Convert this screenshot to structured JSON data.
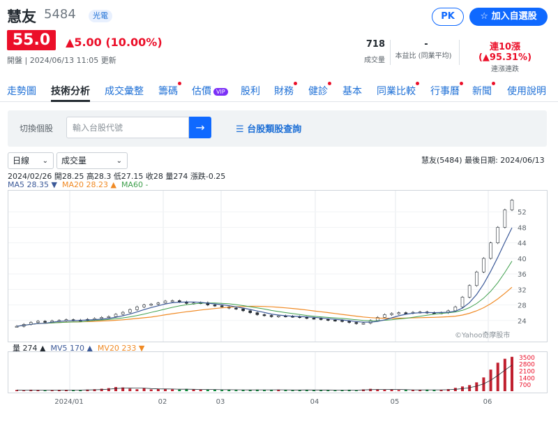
{
  "stock": {
    "name": "慧友",
    "code": "5484",
    "sector": "光電",
    "price": "55.0",
    "change": "5.00 (10.00%)",
    "market_time": "開盤 | 2024/06/13 11:05 更新"
  },
  "actions": {
    "pk": "PK",
    "watch": "加入自選股"
  },
  "stats": [
    {
      "value": "718",
      "label": "成交量",
      "color": "#232a31"
    },
    {
      "value": "-",
      "label": "本益比 (同業平均)",
      "color": "#232a31"
    },
    {
      "value": "連10漲 (▲95.31%)",
      "label": "連漲連跌",
      "color": "#eb0f29"
    }
  ],
  "tabs": [
    {
      "label": "走勢圖",
      "dot": false,
      "vip": false
    },
    {
      "label": "技術分析",
      "dot": false,
      "vip": false,
      "active": true
    },
    {
      "label": "成交彙整",
      "dot": false,
      "vip": false
    },
    {
      "label": "籌碼",
      "dot": true,
      "vip": false
    },
    {
      "label": "估價",
      "dot": false,
      "vip": true
    },
    {
      "label": "股利",
      "dot": false,
      "vip": false
    },
    {
      "label": "財務",
      "dot": true,
      "vip": false
    },
    {
      "label": "健診",
      "dot": true,
      "vip": false
    },
    {
      "label": "基本",
      "dot": false,
      "vip": false
    },
    {
      "label": "同業比較",
      "dot": true,
      "vip": false
    },
    {
      "label": "行事曆",
      "dot": true,
      "vip": false
    },
    {
      "label": "新聞",
      "dot": true,
      "vip": false
    },
    {
      "label": "使用說明",
      "dot": false,
      "vip": false
    }
  ],
  "vip_badge": "VIP",
  "search": {
    "label": "切換個股",
    "placeholder": "輸入台股代號",
    "go": "→",
    "browse": "台股類股查詢"
  },
  "controls": {
    "period": "日線",
    "indicator": "成交量"
  },
  "chart_info": "慧友(5484)   最後日期: 2024/06/13",
  "ohlc": "2024/02/26 開28.25 高28.3 低27.15 收28 量274 漲跌-0.25",
  "ma_legend": [
    {
      "text": "MA5 28.35 ▼",
      "color": "#3b5998"
    },
    {
      "text": "MA20 28.23 ▲",
      "color": "#f08a24"
    },
    {
      "text": "MA60 -",
      "color": "#3e9f4c"
    }
  ],
  "vol_legend": [
    {
      "text": "量 274 ▲",
      "color": "#232a31"
    },
    {
      "text": "MV5 170 ▲",
      "color": "#3b5998"
    },
    {
      "text": "MV20 233 ▼",
      "color": "#f08a24"
    }
  ],
  "watermark": "©Yahoo奇摩股市",
  "chart_data": {
    "type": "line",
    "price_ticks": [
      "52",
      "48",
      "44",
      "40",
      "36",
      "32",
      "28",
      "24"
    ],
    "volume_ticks": [
      "3500",
      "2800",
      "2100",
      "1400",
      "700"
    ],
    "x_labels": [
      "2024/01",
      "02",
      "03",
      "04",
      "05",
      "06"
    ],
    "close": [
      22.5,
      23,
      23.5,
      23.8,
      23.6,
      23.9,
      24,
      24.2,
      24.1,
      24,
      24.3,
      24.5,
      24.8,
      25,
      25.6,
      26.1,
      26.8,
      27.5,
      28,
      28.2,
      28.5,
      29,
      29.1,
      28.8,
      28.4,
      28.5,
      28.6,
      28,
      27.8,
      27.5,
      27.2,
      27,
      26.5,
      26,
      25.5,
      25.3,
      25,
      25.2,
      25.1,
      25,
      24.8,
      24.6,
      24.5,
      24.3,
      24.1,
      24,
      23.8,
      23.5,
      23.2,
      23.3,
      24,
      24.8,
      25.5,
      25.8,
      26,
      25.9,
      26.1,
      26.2,
      26,
      25.9,
      26,
      26.5,
      27.5,
      30,
      33,
      36.5,
      40,
      44,
      48,
      52.5,
      55
    ],
    "volume": [
      120,
      80,
      150,
      100,
      90,
      110,
      130,
      140,
      95,
      100,
      160,
      200,
      250,
      310,
      420,
      380,
      260,
      200,
      300,
      180,
      240,
      210,
      190,
      160,
      230,
      170,
      150,
      140,
      160,
      130,
      150,
      120,
      110,
      140,
      160,
      130,
      120,
      150,
      110,
      100,
      130,
      140,
      120,
      110,
      100,
      90,
      130,
      150,
      80,
      180,
      240,
      200,
      170,
      150,
      120,
      130,
      110,
      140,
      160,
      120,
      130,
      210,
      340,
      480,
      620,
      900,
      1400,
      2200,
      2900,
      3300,
      3500
    ]
  }
}
